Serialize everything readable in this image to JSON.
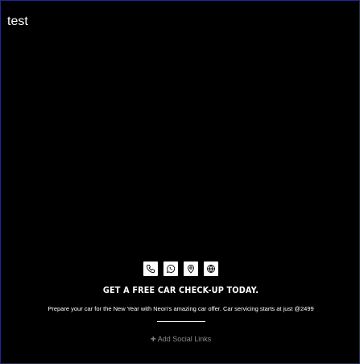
{
  "page": {
    "title": "test"
  },
  "contact_icons": [
    {
      "icon": "phone-icon"
    },
    {
      "icon": "whatsapp-icon"
    },
    {
      "icon": "location-pin-icon"
    },
    {
      "icon": "globe-icon"
    }
  ],
  "promo": {
    "headline": "GET A FREE CAR CHECK-UP TODAY.",
    "description": "Prepare your car for the New Year with Neon's amazing car offer. Car servicing starts at just @2499"
  },
  "social": {
    "plus_glyph": "+",
    "add_label": "Add Social Links"
  },
  "colors": {
    "background": "#000000",
    "text": "#ffffff",
    "muted": "#8a8a8a",
    "border": "#2a2a6a"
  }
}
